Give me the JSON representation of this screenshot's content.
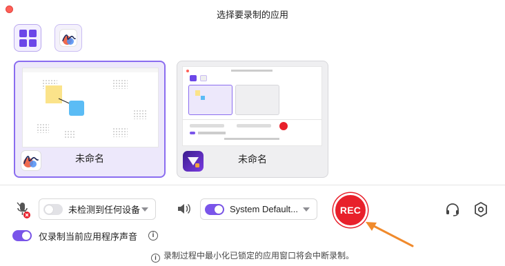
{
  "window": {
    "title": "选择要录制的应用"
  },
  "view_toggles": [
    {
      "name": "grid-view",
      "icon": "grid-icon"
    },
    {
      "name": "app-view",
      "icon": "app-logo-icon"
    }
  ],
  "apps": [
    {
      "label": "未命名",
      "icon": "whiteboard-app-icon",
      "selected": true
    },
    {
      "label": "未命名",
      "icon": "recorder-app-icon",
      "selected": false
    }
  ],
  "audio": {
    "mic_device_label": "未检测到任何设备",
    "mic_enabled": false,
    "system_audio_label": "System Default...",
    "system_audio_enabled": true,
    "app_audio_only_label": "仅录制当前应用程序声音",
    "app_audio_only_enabled": true
  },
  "record": {
    "button_label": "REC"
  },
  "notice": {
    "text": "录制过程中最小化已锁定的应用窗口将会中断录制。",
    "info_glyph": "i"
  },
  "colors": {
    "accent": "#7a55ea",
    "rec_red": "#e8202b",
    "arrow_orange": "#f08a2c"
  }
}
